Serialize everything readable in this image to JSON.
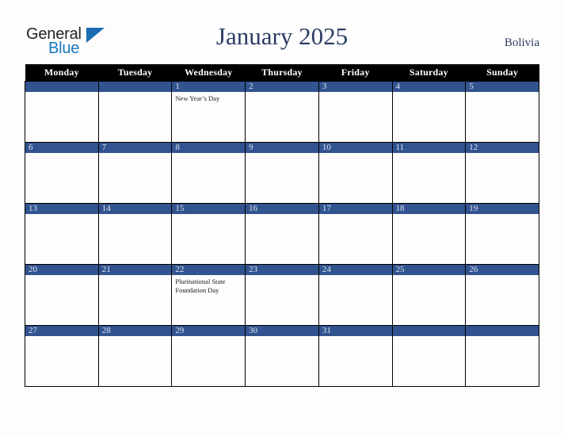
{
  "brand": {
    "word1": "General",
    "word2": "Blue",
    "triangle_icon": "triangle-right-icon",
    "color_dark": "#231f20",
    "color_blue": "#1878be"
  },
  "header": {
    "title": "January 2025",
    "country": "Bolivia",
    "title_color": "#2c3d63"
  },
  "calendar": {
    "header_bg": "#000000",
    "daynum_bg": "#31538f",
    "cell_bg": "#fdfdfd",
    "grid_color": "#000000",
    "weekdays": [
      "Monday",
      "Tuesday",
      "Wednesday",
      "Thursday",
      "Friday",
      "Saturday",
      "Sunday"
    ],
    "weeks": [
      [
        {
          "day": "",
          "event": ""
        },
        {
          "day": "",
          "event": ""
        },
        {
          "day": "1",
          "event": "New Year’s Day"
        },
        {
          "day": "2",
          "event": ""
        },
        {
          "day": "3",
          "event": ""
        },
        {
          "day": "4",
          "event": ""
        },
        {
          "day": "5",
          "event": ""
        }
      ],
      [
        {
          "day": "6",
          "event": ""
        },
        {
          "day": "7",
          "event": ""
        },
        {
          "day": "8",
          "event": ""
        },
        {
          "day": "9",
          "event": ""
        },
        {
          "day": "10",
          "event": ""
        },
        {
          "day": "11",
          "event": ""
        },
        {
          "day": "12",
          "event": ""
        }
      ],
      [
        {
          "day": "13",
          "event": ""
        },
        {
          "day": "14",
          "event": ""
        },
        {
          "day": "15",
          "event": ""
        },
        {
          "day": "16",
          "event": ""
        },
        {
          "day": "17",
          "event": ""
        },
        {
          "day": "18",
          "event": ""
        },
        {
          "day": "19",
          "event": ""
        }
      ],
      [
        {
          "day": "20",
          "event": ""
        },
        {
          "day": "21",
          "event": ""
        },
        {
          "day": "22",
          "event": "Plurinational State Foundation Day"
        },
        {
          "day": "23",
          "event": ""
        },
        {
          "day": "24",
          "event": ""
        },
        {
          "day": "25",
          "event": ""
        },
        {
          "day": "26",
          "event": ""
        }
      ],
      [
        {
          "day": "27",
          "event": ""
        },
        {
          "day": "28",
          "event": ""
        },
        {
          "day": "29",
          "event": ""
        },
        {
          "day": "30",
          "event": ""
        },
        {
          "day": "31",
          "event": ""
        },
        {
          "day": "",
          "event": ""
        },
        {
          "day": "",
          "event": ""
        }
      ]
    ]
  }
}
